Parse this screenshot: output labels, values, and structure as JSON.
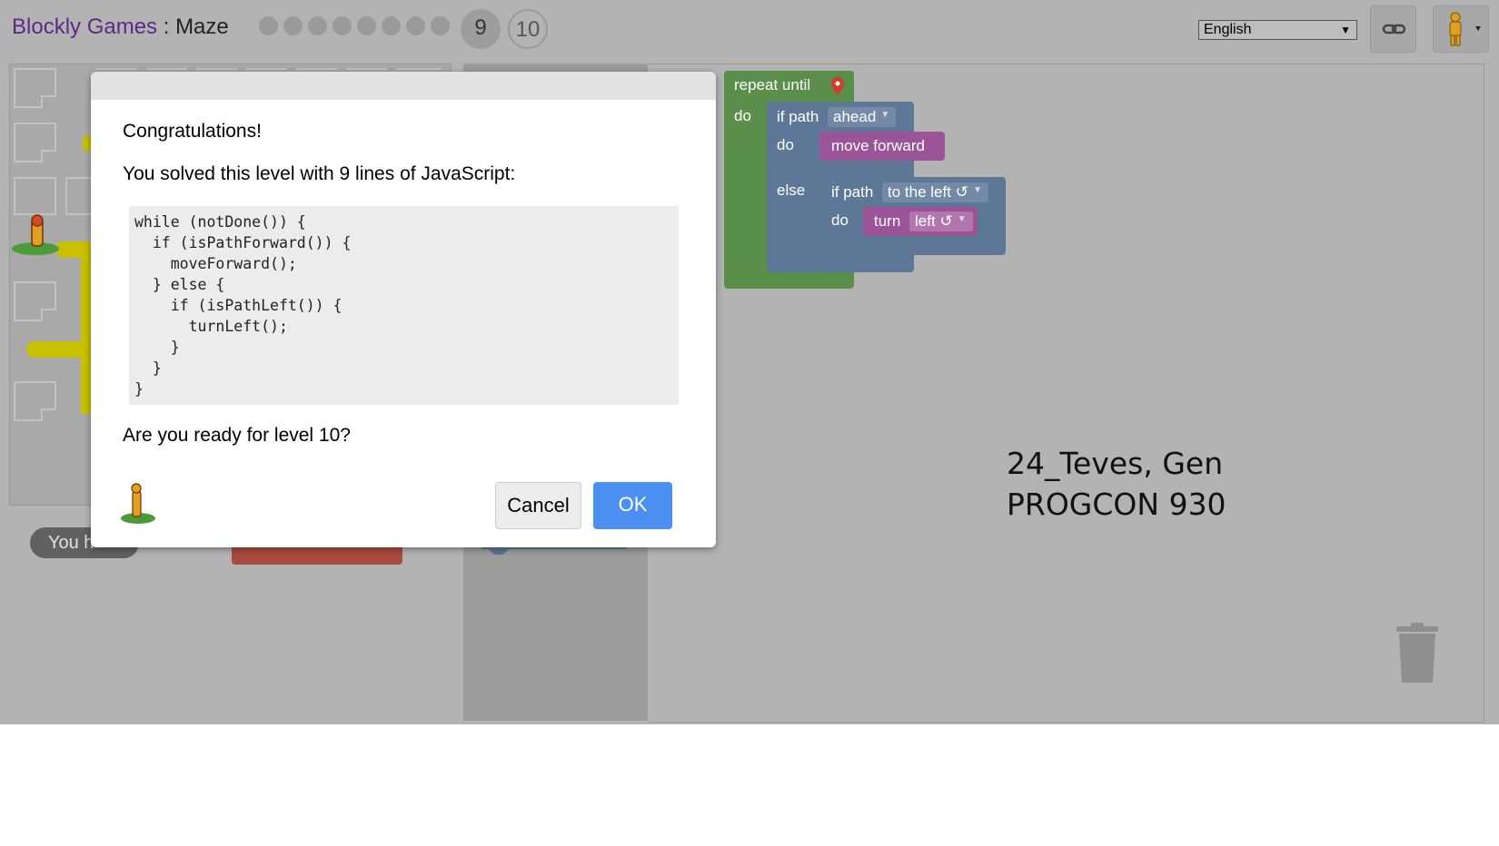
{
  "header": {
    "app_name": "Blockly Games",
    "separator": " : ",
    "game_name": "Maze",
    "current_level": "9",
    "next_level": "10",
    "completed_dots": 8,
    "language": "English"
  },
  "workspace": {
    "repeat_label": "repeat until",
    "do_label": "do",
    "if_path_label": "if path",
    "ahead_option": "ahead",
    "move_forward_label": "move forward",
    "else_label": "else",
    "to_the_left_option": "to the left ↺",
    "turn_label": "turn",
    "left_option": "left ↺"
  },
  "maze": {
    "status_text": "You h"
  },
  "overlay": {
    "line1": "24_Teves, Gen",
    "line2": "PROGCON 930"
  },
  "dialog": {
    "heading": "Congratulations!",
    "message": "You solved this level with 9 lines of JavaScript:",
    "code_lines": [
      "while (notDone()) {",
      "  if (isPathForward()) {",
      "    moveForward();",
      "  } else {",
      "    if (isPathLeft()) {",
      "      turnLeft();",
      "    }",
      "  }",
      "}"
    ],
    "question": "Are you ready for level 10?",
    "cancel_label": "Cancel",
    "ok_label": "OK"
  },
  "colors": {
    "loop_block": "#5a8f4b",
    "logic_block": "#5c7896",
    "action_block": "#9b5497",
    "ok_button": "#4c8ff3"
  }
}
